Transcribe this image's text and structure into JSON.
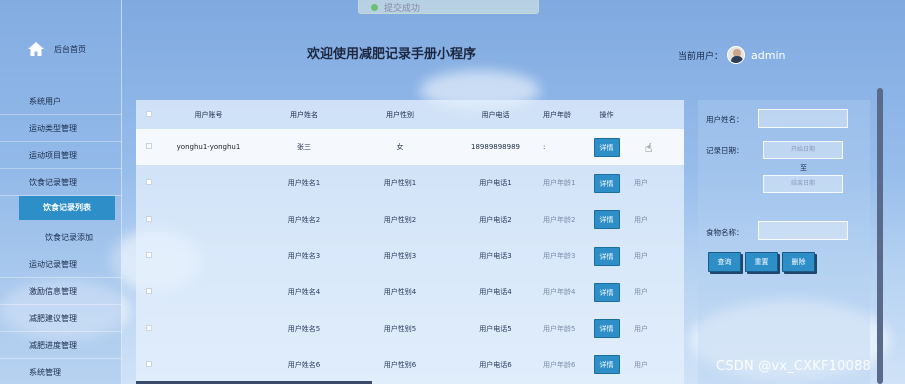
{
  "toast": {
    "text": "提交成功"
  },
  "sidebar": {
    "home_label": "后台首页",
    "items": [
      {
        "label": "系统用户",
        "type": "normal"
      },
      {
        "label": "运动类型管理",
        "type": "normal"
      },
      {
        "label": "运动项目管理",
        "type": "normal"
      },
      {
        "label": "饮食记录管理",
        "type": "normal"
      },
      {
        "label": "饮食记录列表",
        "type": "active"
      },
      {
        "label": "饮食记录添加",
        "type": "sub"
      },
      {
        "label": "运动记录管理",
        "type": "normal"
      },
      {
        "label": "激励信息管理",
        "type": "normal"
      },
      {
        "label": "减肥建议管理",
        "type": "normal"
      },
      {
        "label": "减肥进度管理",
        "type": "normal"
      },
      {
        "label": "系统管理",
        "type": "normal"
      }
    ]
  },
  "header": {
    "title": "欢迎使用减肥记录手册小程序",
    "user_label": "当前用户：",
    "user_name": "admin"
  },
  "table": {
    "columns": [
      "",
      "用户账号",
      "用户姓名",
      "用户性别",
      "用户电话",
      "用户年龄",
      "操作",
      ""
    ],
    "detail_label": "详情",
    "rows": [
      {
        "account": "yonghu1-yonghu1",
        "name": "张三",
        "gender": "女",
        "phone": "18989898989",
        "age": ":",
        "extra": ""
      },
      {
        "account": "",
        "name": "用户姓名1",
        "gender": "用户性别1",
        "phone": "用户电话1",
        "age": "用户年龄1",
        "extra": "用户"
      },
      {
        "account": "",
        "name": "用户姓名2",
        "gender": "用户性别2",
        "phone": "用户电话2",
        "age": "用户年龄2",
        "extra": "用户"
      },
      {
        "account": "",
        "name": "用户姓名3",
        "gender": "用户性别3",
        "phone": "用户电话3",
        "age": "用户年龄3",
        "extra": "用户"
      },
      {
        "account": "",
        "name": "用户姓名4",
        "gender": "用户性别4",
        "phone": "用户电话4",
        "age": "用户年龄4",
        "extra": "用户"
      },
      {
        "account": "",
        "name": "用户姓名5",
        "gender": "用户性别5",
        "phone": "用户电话5",
        "age": "用户年龄5",
        "extra": "用户"
      },
      {
        "account": "",
        "name": "用户姓名6",
        "gender": "用户性别6",
        "phone": "用户电话6",
        "age": "用户年龄6",
        "extra": "用户"
      }
    ]
  },
  "search": {
    "name_label": "用户姓名：",
    "name_value": "",
    "date_label": "记录日期：",
    "start_placeholder": "开始日期",
    "to_label": "至",
    "end_placeholder": "结束日期",
    "food_label": "食物名称：",
    "food_value": "",
    "query_button": "查询",
    "reset_button": "重置",
    "delete_button": "删除"
  },
  "watermark": "CSDN @vx_CXKF10088",
  "colors": {
    "accent": "#2d8ec8",
    "sidebar_text": "#1a2a4a"
  }
}
